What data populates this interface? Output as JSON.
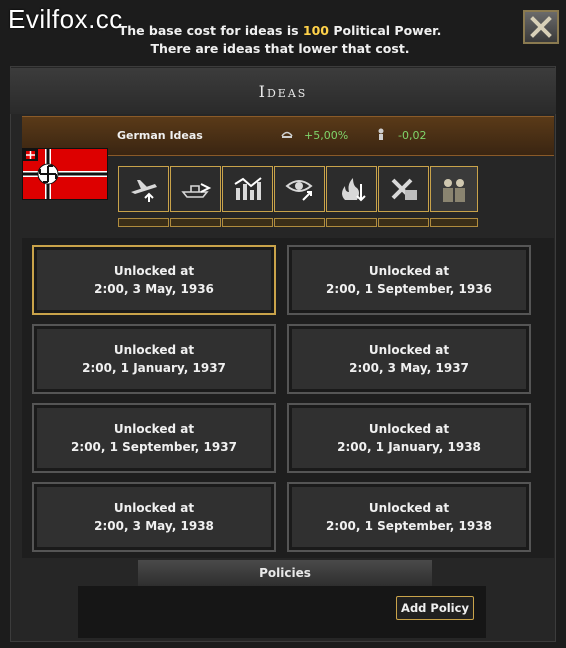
{
  "watermark": "Evilfox.cc",
  "header": {
    "prefix": "The base cost for ideas is ",
    "cost": "100",
    "suffix": " Political Power.",
    "line2": "There are ideas that lower that cost."
  },
  "title": "Ideas",
  "nation": {
    "name": "German Ideas",
    "stat_a": "+5,00%",
    "stat_b": "-0,02",
    "stat_a_icon": "political-power-icon",
    "stat_b_icon": "stability-icon"
  },
  "slot_icons": [
    "air-force-icon",
    "navy-icon",
    "economy-icon",
    "intelligence-icon",
    "industry-icon",
    "army-icon",
    "high-command-icon"
  ],
  "cards": [
    {
      "label": "Unlocked at",
      "date": "2:00, 3 May, 1936"
    },
    {
      "label": "Unlocked at",
      "date": "2:00, 1 September, 1936"
    },
    {
      "label": "Unlocked at",
      "date": "2:00, 1 January, 1937"
    },
    {
      "label": "Unlocked at",
      "date": "2:00, 3 May, 1937"
    },
    {
      "label": "Unlocked at",
      "date": "2:00, 1 September, 1937"
    },
    {
      "label": "Unlocked at",
      "date": "2:00, 1 January, 1938"
    },
    {
      "label": "Unlocked at",
      "date": "2:00, 3 May, 1938"
    },
    {
      "label": "Unlocked at",
      "date": "2:00, 1 September, 1938"
    }
  ],
  "policies": {
    "title": "Policies",
    "add_button": "Add Policy"
  },
  "colors": {
    "accent_gold": "#c9a34a",
    "highlight_yellow": "#ffd24a",
    "positive_green": "#7fd56a",
    "flag_red": "#dd0000"
  }
}
